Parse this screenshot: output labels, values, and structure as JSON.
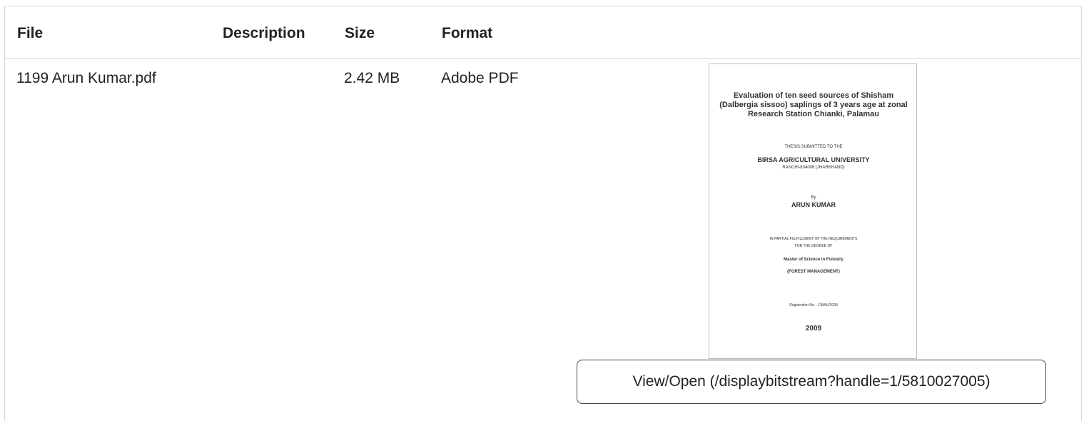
{
  "table": {
    "headers": {
      "file": "File",
      "description": "Description",
      "size": "Size",
      "format": "Format"
    },
    "rows": [
      {
        "file": "1199 Arun Kumar.pdf",
        "description": "",
        "size": "2.42 MB",
        "format": "Adobe PDF"
      }
    ]
  },
  "thumbnail": {
    "title": "Evaluation of ten seed sources of Shisham (Dalbergia sissoo) saplings of 3 years age at zonal Research Station Chianki, Palamau",
    "thesis_line": "THESIS SUBMITTED TO THE",
    "university": "BIRSA AGRICULTURAL UNIVERSITY",
    "ranchi": "RANCHI-834006 (JHARKHAND)",
    "by": "By",
    "author": "ARUN KUMAR",
    "partial": "IN PARTIAL FULFILLMENT OF THE REQUIREMENTS",
    "for_degree": "FOR THE DEGREE OF",
    "degree": "Master of Science in Forestry",
    "specialization": "(FOREST MANAGEMENT)",
    "registration": "Registration No. - F/BAU/2008",
    "year": "2009"
  },
  "view_button": {
    "label": "View/Open (/displaybitstream?handle=1/5810027005)"
  }
}
